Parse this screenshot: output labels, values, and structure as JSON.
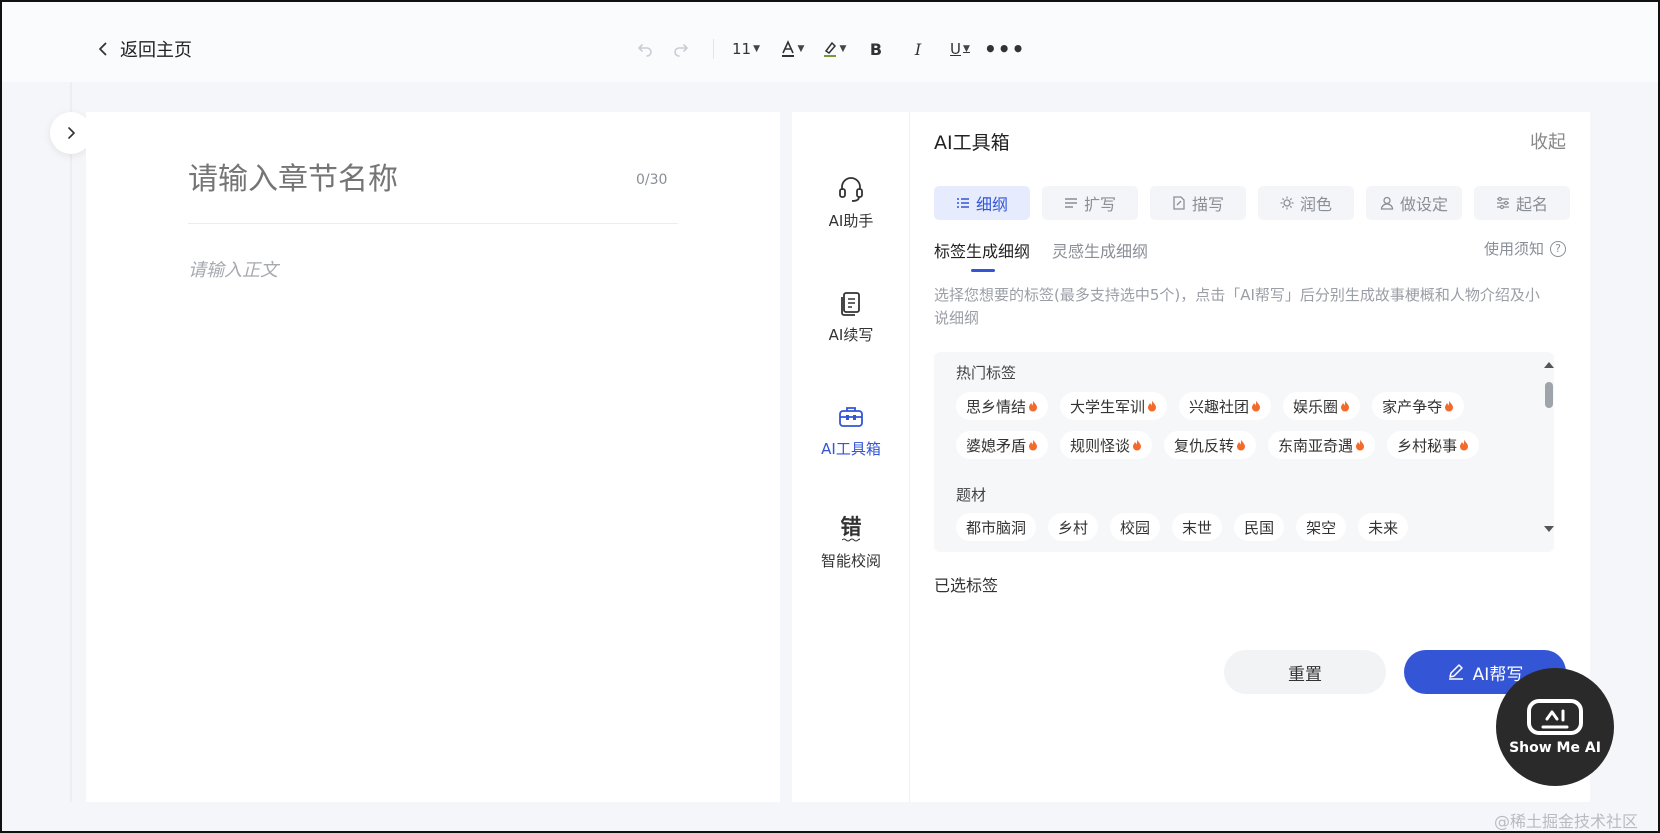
{
  "header": {
    "back_label": "返回主页",
    "font_size": "11",
    "icons": [
      "undo-icon",
      "redo-icon",
      "font-color-icon",
      "highlight-icon",
      "bold-icon",
      "italic-icon",
      "underline-icon",
      "more-icon"
    ]
  },
  "editor": {
    "title_placeholder": "请输入章节名称",
    "title_count": "0/30",
    "body_placeholder": "请输入正文"
  },
  "sidenav": {
    "items": [
      {
        "label": "AI助手",
        "icon": "headset-icon"
      },
      {
        "label": "AI续写",
        "icon": "document-icon"
      },
      {
        "label": "AI工具箱",
        "icon": "toolbox-icon"
      },
      {
        "label": "智能校阅",
        "glyph": "错",
        "icon": "proofread-icon"
      }
    ],
    "active": "AI工具箱"
  },
  "panel": {
    "title": "AI工具箱",
    "collapse": "收起",
    "tabs": [
      {
        "label": "细纲",
        "icon": "list-icon"
      },
      {
        "label": "扩写",
        "icon": "lines-icon"
      },
      {
        "label": "描写",
        "icon": "edit-doc-icon"
      },
      {
        "label": "润色",
        "icon": "sun-icon"
      },
      {
        "label": "做设定",
        "icon": "user-icon"
      },
      {
        "label": "起名",
        "icon": "sliders-icon"
      }
    ],
    "active_tab": "细纲",
    "subtabs": [
      "标签生成细纲",
      "灵感生成细纲"
    ],
    "active_subtab": "标签生成细纲",
    "notice": "使用须知",
    "hint": "选择您想要的标签(最多支持选中5个)，点击「AI帮写」后分别生成故事梗概和人物介绍及小说细纲",
    "hot_title": "热门标签",
    "hot_row1": [
      "思乡情结",
      "大学生军训",
      "兴趣社团",
      "娱乐圈",
      "家产争夺"
    ],
    "hot_row2": [
      "婆媳矛盾",
      "规则怪谈",
      "复仇反转",
      "东南亚奇遇",
      "乡村秘事"
    ],
    "topic_title": "题材",
    "topic_row": [
      "都市脑洞",
      "乡村",
      "校园",
      "末世",
      "民国",
      "架空",
      "未来"
    ],
    "selected_label": "已选标签",
    "reset_label": "重置",
    "ai_label": "AI帮写"
  },
  "logo": {
    "text": "Show Me AI"
  },
  "watermark": "@稀土掘金技术社区",
  "colors": {
    "accent": "#3355d6",
    "flame": "#f26b2a"
  }
}
